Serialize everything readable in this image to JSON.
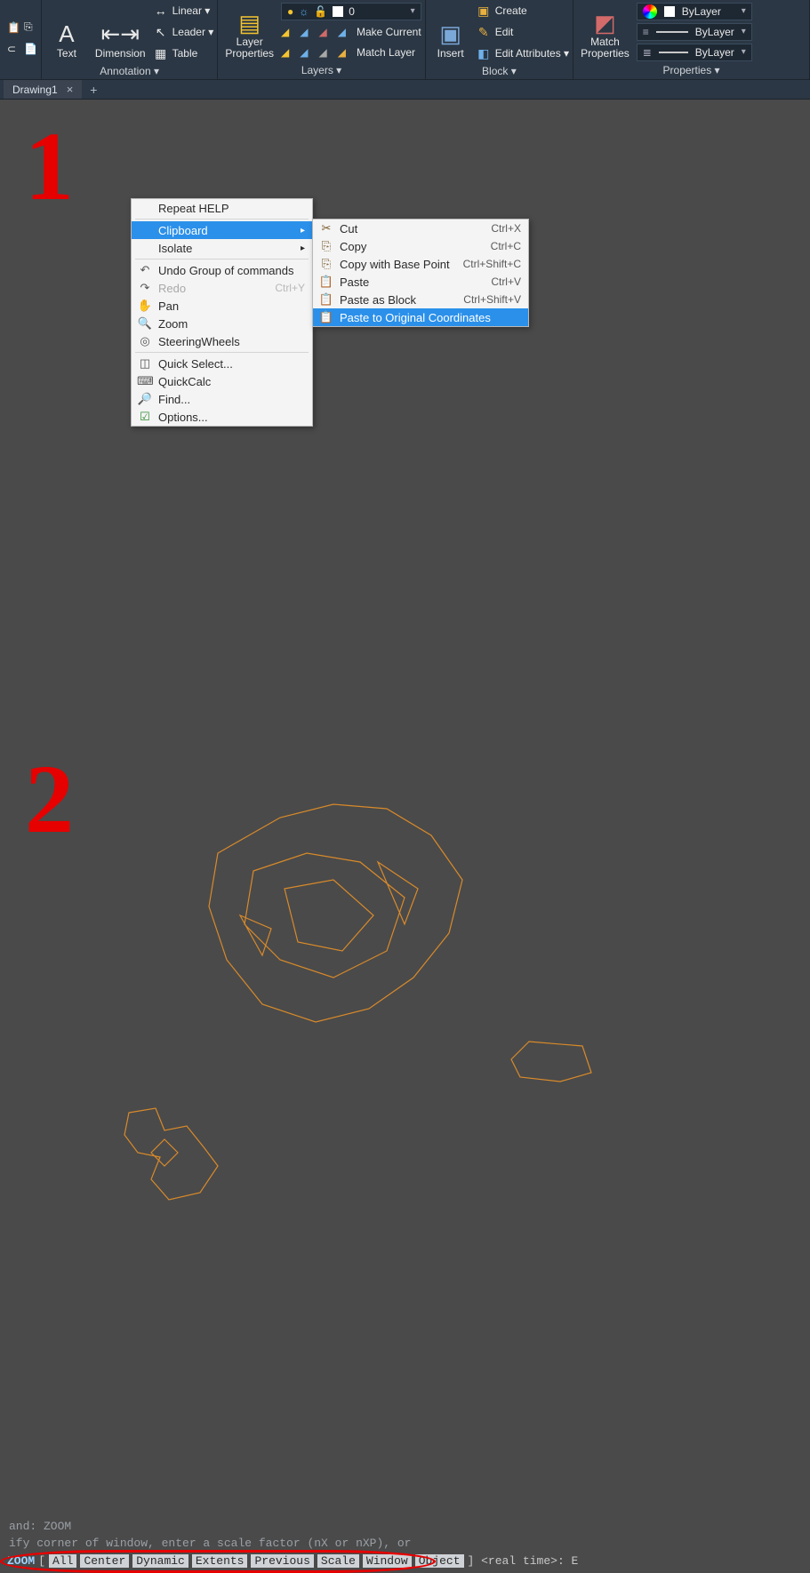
{
  "ribbon": {
    "panels": {
      "annotation": {
        "title": "Annotation ▾",
        "text": "Text",
        "dimension": "Dimension",
        "linear": "Linear ▾",
        "leader": "Leader ▾",
        "table": "Table"
      },
      "layers": {
        "title": "Layers ▾",
        "layer_props": "Layer\nProperties",
        "combo_value": "0",
        "make_current": "Make Current",
        "match_layer": "Match Layer"
      },
      "block": {
        "title": "Block ▾",
        "insert": "Insert",
        "create": "Create",
        "edit": "Edit",
        "edit_attributes": "Edit Attributes ▾"
      },
      "properties": {
        "title": "Properties ▾",
        "match": "Match\nProperties",
        "bylayer1": "ByLayer",
        "bylayer2": "ByLayer",
        "bylayer3": "ByLayer"
      }
    }
  },
  "tabs": {
    "drawing1": "Drawing1"
  },
  "steps": {
    "one": "1",
    "two": "2"
  },
  "ctxmenu": {
    "repeat": "Repeat HELP",
    "clipboard": "Clipboard",
    "isolate": "Isolate",
    "undo": "Undo Group of commands",
    "redo": "Redo",
    "redo_sc": "Ctrl+Y",
    "pan": "Pan",
    "zoom": "Zoom",
    "steering": "SteeringWheels",
    "quick_select": "Quick Select...",
    "quickcalc": "QuickCalc",
    "find": "Find...",
    "options": "Options..."
  },
  "submenu": {
    "cut": "Cut",
    "cut_sc": "Ctrl+X",
    "copy": "Copy",
    "copy_sc": "Ctrl+C",
    "copybp": "Copy with Base Point",
    "copybp_sc": "Ctrl+Shift+C",
    "paste": "Paste",
    "paste_sc": "Ctrl+V",
    "pasteblock": "Paste as Block",
    "pasteblock_sc": "Ctrl+Shift+V",
    "pasteorig": "Paste to Original Coordinates"
  },
  "cmd": {
    "hist1": "and: ZOOM",
    "hist2": "ify corner of window, enter a scale factor (nX or nXP), or",
    "head": "ZOOM",
    "opts": [
      "All",
      "Center",
      "Dynamic",
      "Extents",
      "Previous",
      "Scale",
      "Window",
      "Object"
    ],
    "tail": "] <real time>: E"
  }
}
